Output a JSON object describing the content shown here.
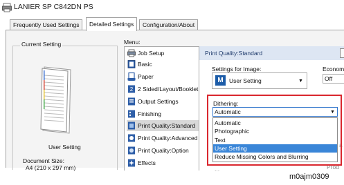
{
  "window": {
    "title": "LANIER SP C842DN PS"
  },
  "tabs": [
    {
      "label": "Frequently Used Settings",
      "active": false
    },
    {
      "label": "Detailed Settings",
      "active": true
    },
    {
      "label": "Configuration/About",
      "active": false
    }
  ],
  "current_setting": {
    "legend": "Current Setting",
    "setting_name": "User Setting",
    "document_size_label": "Document Size:",
    "document_size_value": "A4 (210 x 297 mm)"
  },
  "menu": {
    "label": "Menu:",
    "items": [
      {
        "label": "Job Setup",
        "icon": "printer-icon",
        "selected": false
      },
      {
        "label": "Basic",
        "icon": "page-icon",
        "selected": false
      },
      {
        "label": "Paper",
        "icon": "paper-icon",
        "selected": false
      },
      {
        "label": "2 Sided/Layout/Booklet",
        "icon": "duplex-icon",
        "selected": false
      },
      {
        "label": "Output Settings",
        "icon": "output-icon",
        "selected": false
      },
      {
        "label": "Finishing",
        "icon": "finishing-icon",
        "selected": false
      },
      {
        "label": "Print Quality:Standard",
        "icon": "quality-icon",
        "selected": true
      },
      {
        "label": "Print Quality:Advanced",
        "icon": "quality-advanced-icon",
        "selected": false
      },
      {
        "label": "Print Quality:Option",
        "icon": "quality-option-icon",
        "selected": false
      },
      {
        "label": "Effects",
        "icon": "effects-icon",
        "selected": false
      }
    ]
  },
  "panel": {
    "title": "Print Quality:Standard",
    "settings_for_image": {
      "label": "Settings for Image:",
      "icon_letter": "M",
      "value": "User Setting"
    },
    "economy": {
      "label": "Economy",
      "value": "Off"
    },
    "dithering": {
      "label": "Dithering:",
      "value": "Automatic",
      "options": [
        {
          "label": "Automatic",
          "selected": false
        },
        {
          "label": "Photographic",
          "selected": false
        },
        {
          "label": "Text",
          "selected": false
        },
        {
          "label": "User Setting",
          "selected": true
        },
        {
          "label": "Reduce Missing Colors and Blurring",
          "selected": false
        }
      ]
    },
    "obscured_text": {
      "t1": "a",
      "t2": "...",
      "t3": "Prod"
    }
  },
  "colors": {
    "highlight": "#d9272e",
    "selection": "#3a86d8",
    "panel_header": "#dde6f3"
  },
  "caption": "m0ajm0309"
}
